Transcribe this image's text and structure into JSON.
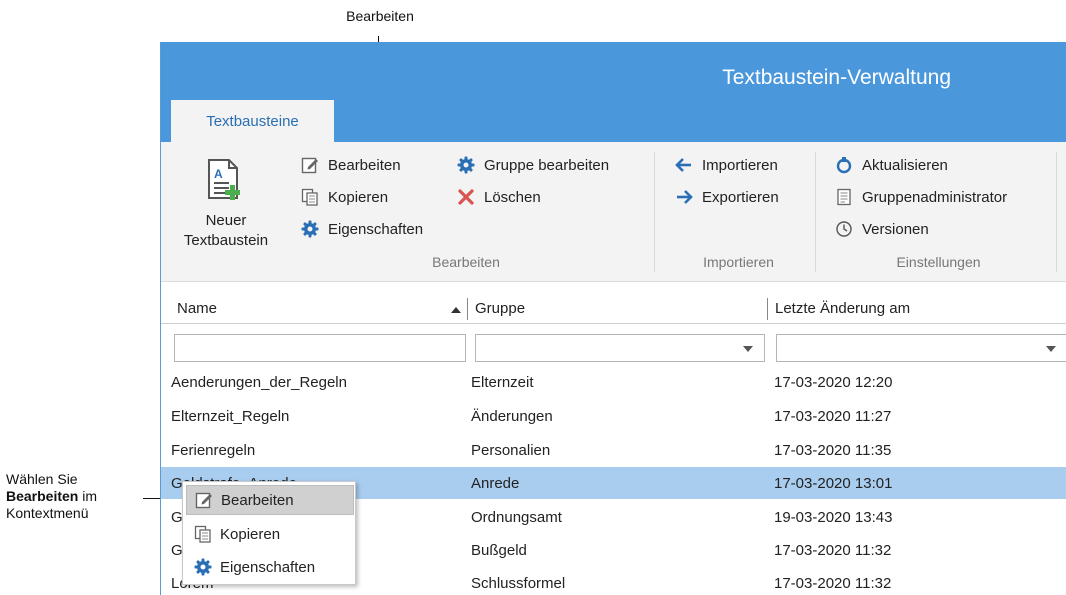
{
  "callouts": {
    "top": "Bearbeiten",
    "left_line1": "Wählen Sie",
    "left_bold": "Bearbeiten",
    "left_after_bold": " im",
    "left_line3": "Kontextmenü"
  },
  "window": {
    "title": "Textbaustein-Verwaltung",
    "tab": "Textbausteine"
  },
  "ribbon": {
    "new_label_1": "Neuer",
    "new_label_2": "Textbaustein",
    "edit": "Bearbeiten",
    "copy": "Kopieren",
    "properties": "Eigenschaften",
    "edit_group": "Gruppe bearbeiten",
    "delete": "Löschen",
    "group_edit_label": "Bearbeiten",
    "import": "Importieren",
    "export": "Exportieren",
    "group_import_label": "Importieren",
    "refresh": "Aktualisieren",
    "group_admin": "Gruppenadministrator",
    "versions": "Versionen",
    "group_settings_label": "Einstellungen"
  },
  "grid": {
    "col_name": "Name",
    "col_group": "Gruppe",
    "col_changed": "Letzte Änderung am",
    "rows": [
      {
        "name": "Aenderungen_der_Regeln",
        "group": "Elternzeit",
        "date": "17-03-2020 12:20"
      },
      {
        "name": "Elternzeit_Regeln",
        "group": "Änderungen",
        "date": "17-03-2020 11:27"
      },
      {
        "name": "Ferienregeln",
        "group": "Personalien",
        "date": "17-03-2020 11:35"
      },
      {
        "name": "Geldstrafe_Anrede",
        "group": "Anrede",
        "date": "17-03-2020 13:01"
      },
      {
        "name": "G",
        "group": "Ordnungsamt",
        "date": "19-03-2020 13:43"
      },
      {
        "name": "G",
        "group": "Bußgeld",
        "date": "17-03-2020 11:32"
      },
      {
        "name": "Lorem",
        "group": "Schlussformel",
        "date": "17-03-2020 11:32"
      }
    ]
  },
  "context_menu": {
    "edit": "Bearbeiten",
    "copy": "Kopieren",
    "properties": "Eigenschaften"
  },
  "colors": {
    "titlebar": "#4a97dc",
    "selection": "#a9cdef",
    "accent_blue": "#2a6fb5",
    "delete_red": "#d9534f"
  }
}
